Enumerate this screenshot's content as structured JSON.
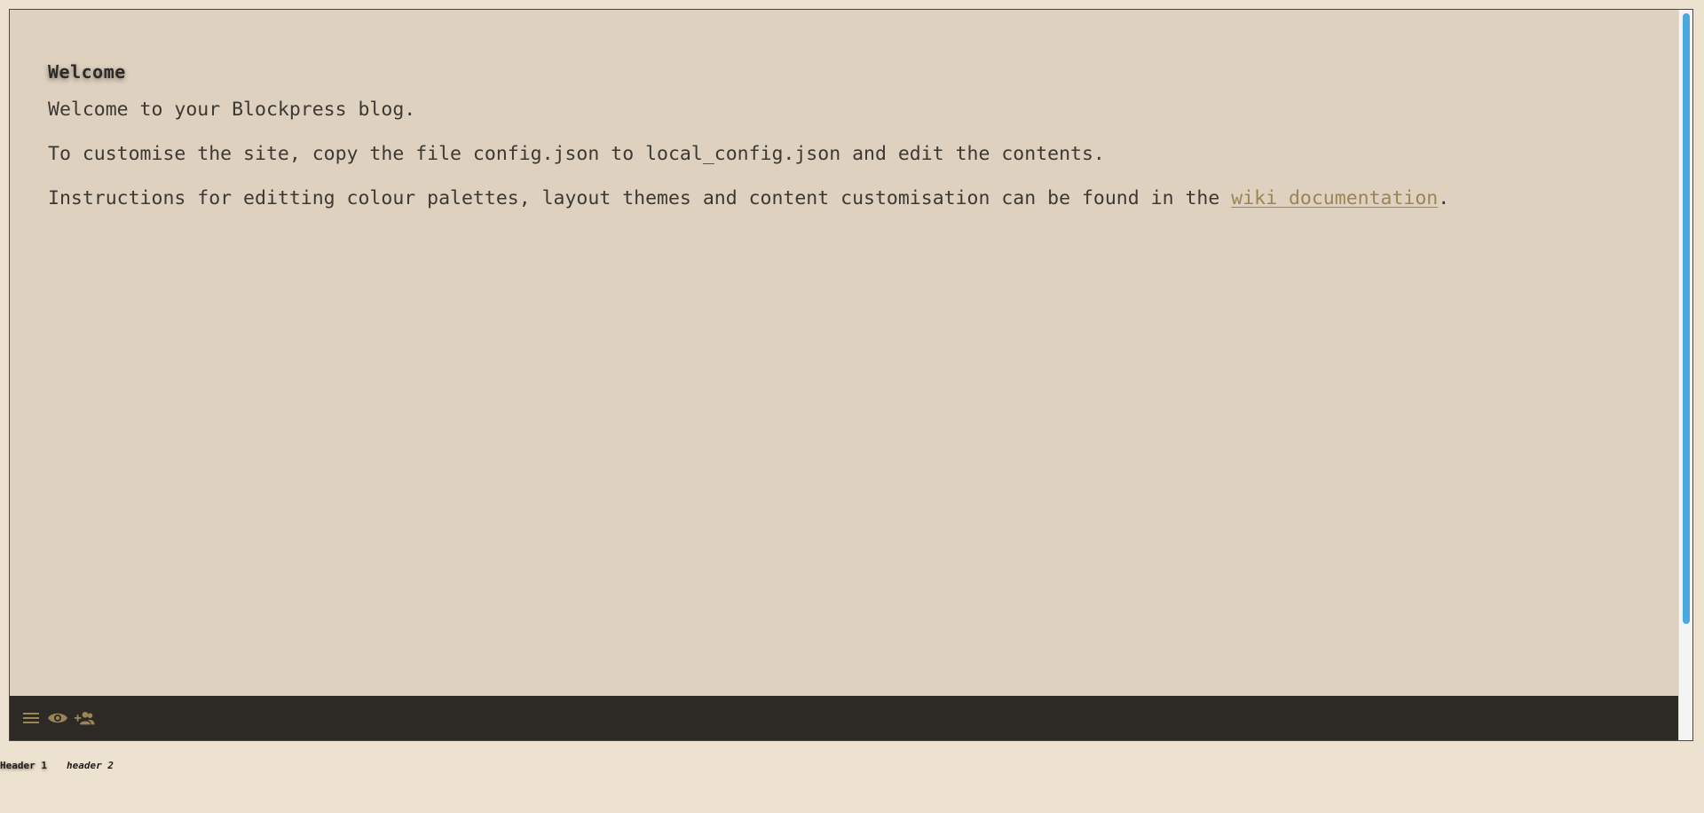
{
  "content": {
    "title": "Welcome",
    "paragraph_1": "Welcome to your Blockpress blog.",
    "paragraph_2": "To customise the site, copy the file config.json to local_config.json and edit the contents.",
    "paragraph_3_prefix": "Instructions for editting colour palettes, layout themes and content customisation can be found in the ",
    "paragraph_3_link": "wiki documentation",
    "paragraph_3_suffix": "."
  },
  "toolbar": {
    "icons": [
      "menu-icon",
      "eye-icon",
      "add-user-icon"
    ]
  },
  "footer_headers": {
    "header_1": "Header 1",
    "header_2": "header 2"
  },
  "colors": {
    "page_background": "#ede1d0",
    "content_background": "#dfd1bf",
    "toolbar_background": "#2d2a26",
    "accent": "#9a8556",
    "scrollbar": "#4aa8e0"
  }
}
